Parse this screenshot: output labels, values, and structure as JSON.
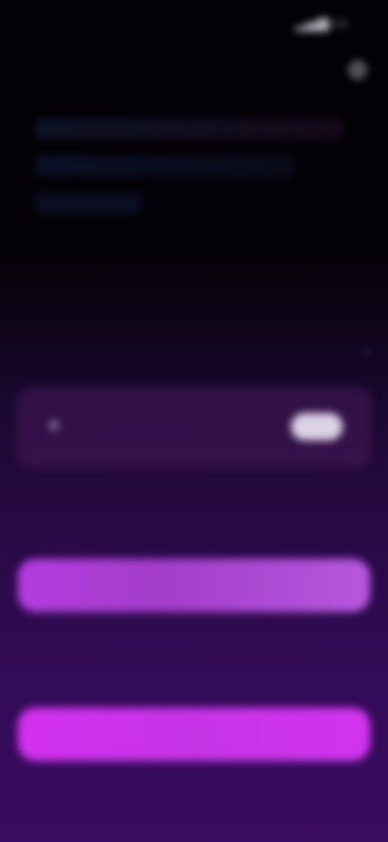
{
  "status_bar": {
    "time": "",
    "icons": [
      "signal-icon",
      "battery-icon"
    ]
  },
  "header": {
    "title": "",
    "settings_icon": "gear-icon"
  },
  "info": {
    "lines": [
      "",
      "",
      ""
    ]
  },
  "center_label": "",
  "section": {
    "title": "",
    "chevron_icon": "chevron-right-icon"
  },
  "card": {
    "title": "",
    "subtitle": "",
    "toggle_on": true
  },
  "row1": {
    "label": "",
    "value": ""
  },
  "bar1": {
    "label": "",
    "value": ""
  },
  "row2": {
    "label": "",
    "value": ""
  },
  "bar2": {
    "label": ""
  },
  "footer": "",
  "colors": {
    "background_top": "#030105",
    "background_bottom": "#3a0b60",
    "accent_bar_1": "#b43ce0",
    "accent_bar_2": "#d230ee",
    "card_background": "#461a5a",
    "toggle": "#dcd2e6"
  }
}
